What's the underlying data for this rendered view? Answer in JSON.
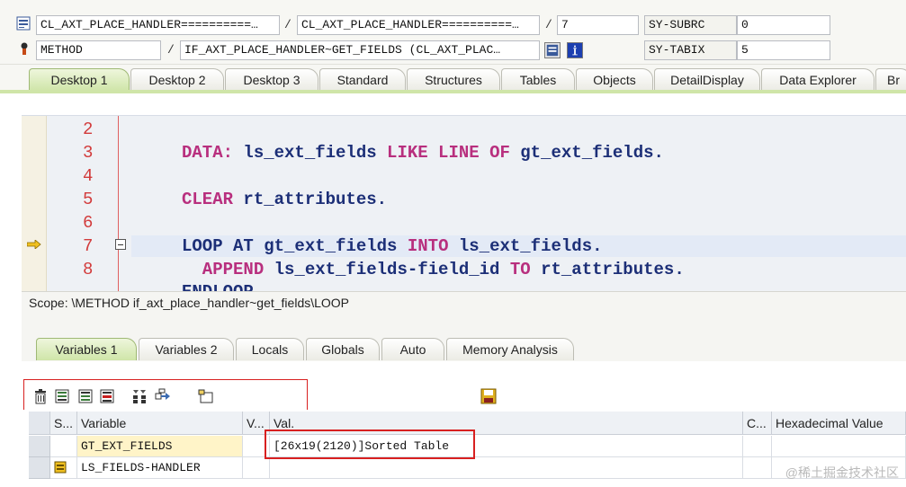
{
  "header": {
    "row1": {
      "field1": "CL_AXT_PLACE_HANDLER==========…",
      "sep1": "/",
      "field2": "CL_AXT_PLACE_HANDLER==========…",
      "sep2": "/",
      "field3": "7",
      "sysvar_label": "SY-SUBRC",
      "sysvar_value": "0"
    },
    "row2": {
      "field1": "METHOD",
      "sep1": "/",
      "field2": "IF_AXT_PLACE_HANDLER~GET_FIELDS (CL_AXT_PLAC…",
      "sysvar_label": "SY-TABIX",
      "sysvar_value": "5"
    }
  },
  "desktop_tabs": [
    "Desktop 1",
    "Desktop 2",
    "Desktop 3",
    "Standard",
    "Structures",
    "Tables",
    "Objects",
    "DetailDisplay",
    "Data Explorer",
    "Br"
  ],
  "code": {
    "line_numbers": [
      "2",
      "3",
      "4",
      "5",
      "6",
      "7",
      "8"
    ],
    "lines": [
      {
        "kw1": "DATA:",
        "id1": " ls_ext_fields ",
        "kw2": "LIKE LINE OF",
        "id2": " gt_ext_fields."
      },
      {
        "kw1": "CLEAR",
        "id1": " rt_attributes."
      },
      {
        "kw1": "LOOP AT",
        "id1": " gt_ext_fields ",
        "kw2": "INTO",
        "id2": " ls_ext_fields."
      },
      {
        "kw1": "  APPEND",
        "id1": " ls_ext_fields-field_id ",
        "kw2": "TO",
        "id2": " rt_attributes."
      },
      {
        "kw1": "ENDLOOP."
      }
    ]
  },
  "scope": "Scope: \\METHOD if_axt_place_handler~get_fields\\LOOP",
  "variable_tabs": [
    "Variables 1",
    "Variables 2",
    "Locals",
    "Globals",
    "Auto",
    "Memory Analysis"
  ],
  "grid": {
    "headers": [
      "S...",
      "Variable",
      "V...",
      "Val.",
      "C...",
      "Hexadecimal Value"
    ],
    "rows": [
      {
        "variable": "GT_EXT_FIELDS",
        "value": "[26x19(2120)]Sorted Table"
      },
      {
        "variable": "LS_FIELDS-HANDLER",
        "value": ""
      }
    ]
  },
  "watermark": "@稀土掘金技术社区",
  "colors": {
    "active_tab": "#cfe5a8",
    "keyword": "#b82f7e",
    "identifier": "#1c2f77",
    "line_number": "#d23b3b",
    "highlight_frame": "#d82020"
  }
}
